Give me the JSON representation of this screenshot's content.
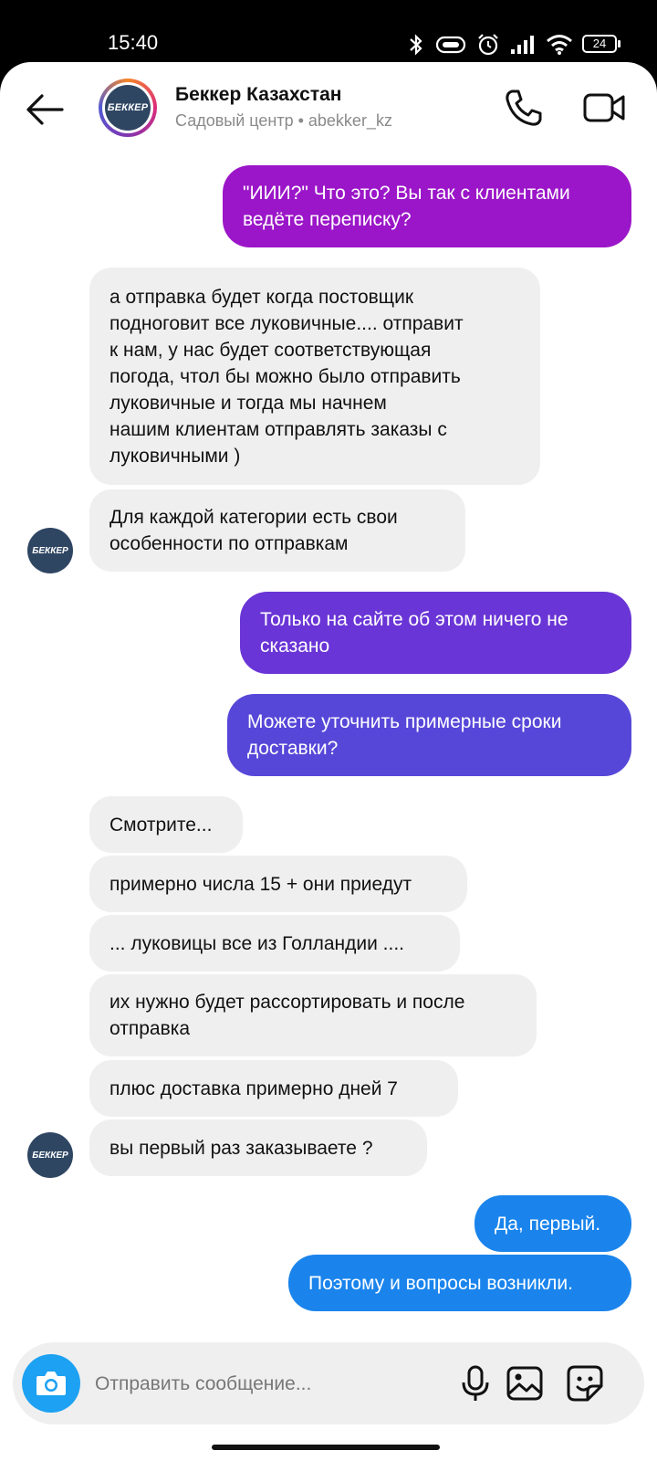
{
  "status_bar": {
    "time": "15:40",
    "battery": "24"
  },
  "header": {
    "contact_name": "Беккер Казахстан",
    "contact_subtitle": "Садовый центр • abekker_kz",
    "avatar_text": "БЕККЕР"
  },
  "messages": [
    {
      "dir": "out",
      "text": "\"ИИИ?\" Что это? Вы так с клиентами\nведёте переписку?",
      "color": "#9b16c8"
    },
    {
      "dir": "in",
      "text": "а отправка будет когда постовщик\nподноговит все луковичные.... отправит\nк нам, у нас будет соответствующая\nпогода, чтол бы можно было отправить\nлуковичные и тогда мы начнем\nнашим клиентам отправлять заказы с\nлуковичными )"
    },
    {
      "dir": "in",
      "text": "Для каждой категории есть свои\nособенности  по отправкам"
    },
    {
      "dir": "out",
      "text": "Только на сайте об этом ничего не\nсказано",
      "color": "#6a35d6"
    },
    {
      "dir": "out",
      "text": "Можете уточнить примерные сроки\nдоставки?",
      "color": "#5747d8"
    },
    {
      "dir": "in",
      "text": "Смотрите..."
    },
    {
      "dir": "in",
      "text": "примерно числа 15 + они приедут"
    },
    {
      "dir": "in",
      "text": "... луковицы все из Голландии ...."
    },
    {
      "dir": "in",
      "text": "их нужно будет рассортировать и после\nотправка"
    },
    {
      "dir": "in",
      "text": "плюс доставка примерно дней 7"
    },
    {
      "dir": "in",
      "text": "вы первый раз заказываете ?"
    },
    {
      "dir": "out",
      "text": "Да, первый.",
      "color": "#1a84ec"
    },
    {
      "dir": "out",
      "text": "Поэтому и вопросы возникли.",
      "color": "#1a84ec"
    }
  ],
  "composer": {
    "placeholder": "Отправить сообщение..."
  }
}
